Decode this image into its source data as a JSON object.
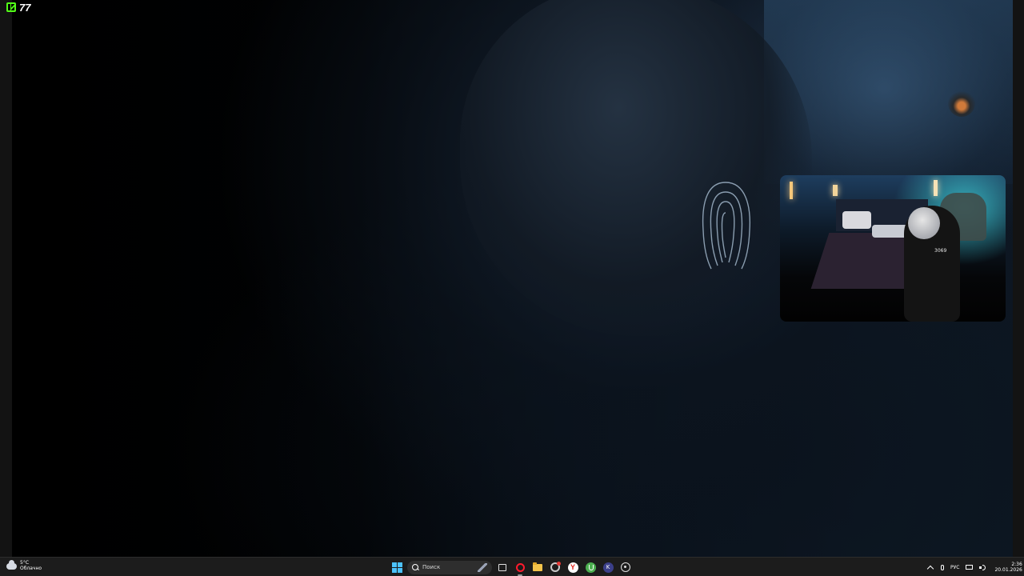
{
  "overlay": {
    "viewer_count": "77"
  },
  "webcam": {
    "caption": "3069"
  },
  "taskbar": {
    "weather": {
      "temperature": "5°C",
      "condition": "Облачно"
    },
    "search": {
      "placeholder": "Поиск"
    },
    "pinned_apps": [
      "start",
      "search",
      "task-view",
      "opera",
      "file-explorer",
      "chrome",
      "yandex-browser",
      "utorrent",
      "app-k",
      "obs"
    ],
    "tray": {
      "language": "РУС",
      "time": "2:36",
      "date": "20.01.2026"
    }
  },
  "colors": {
    "accent": "#53fc18",
    "start": "#4cc2ff",
    "opera": "#ff1b2d",
    "taskbar_bg": "#1c1c1c"
  }
}
